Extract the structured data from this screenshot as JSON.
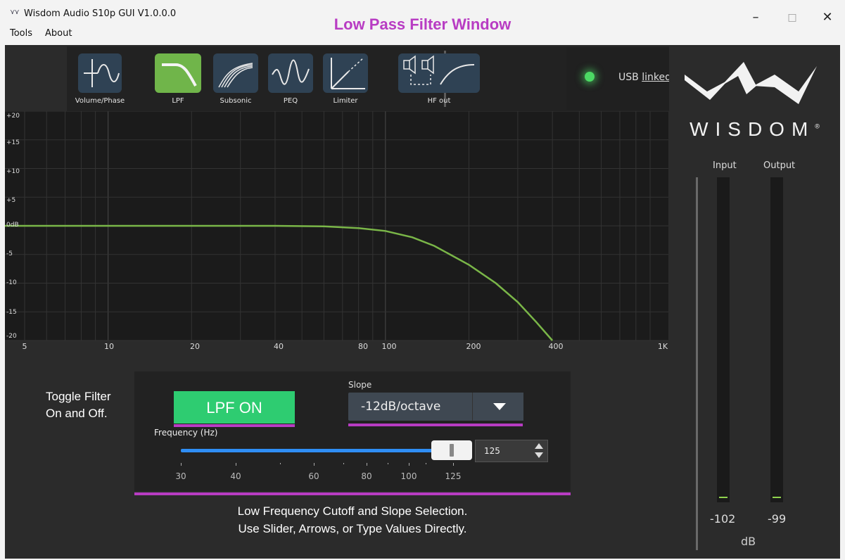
{
  "window": {
    "title": "Wisdom Audio S10p GUI V1.0.0.0",
    "menu": [
      "Tools",
      "About"
    ],
    "controls": [
      "–",
      "□",
      "✕"
    ]
  },
  "annotations": {
    "title": "Low Pass Filter Window",
    "toggle_line1": "Toggle Filter",
    "toggle_line2": "On and Off.",
    "cutoff_line1": "Low Frequency Cutoff and Slope Selection.",
    "cutoff_line2": "Use Slider, Arrows, or Type Values Directly.",
    "highlight_color": "#b83cc3"
  },
  "toolbar": {
    "buttons": [
      {
        "label": "Volume/Phase",
        "icon": "volume-phase-icon",
        "active": false
      },
      {
        "label": "LPF",
        "icon": "lowpass-curve-icon",
        "active": true
      },
      {
        "label": "Subsonic",
        "icon": "subsonic-curves-icon",
        "active": false
      },
      {
        "label": "PEQ",
        "icon": "peq-wave-icon",
        "active": false
      },
      {
        "label": "Limiter",
        "icon": "limiter-graph-icon",
        "active": false
      },
      {
        "label": "HF out",
        "icon": "hf-out-icon",
        "active": false
      }
    ],
    "active_color": "#70b54a",
    "inactive_color": "#2f4254"
  },
  "status": {
    "usb_prefix": "USB",
    "usb_state": "linked",
    "led_color": "#4cd964"
  },
  "graph": {
    "y_labels": [
      "+20",
      "+15",
      "+10",
      "+5",
      "0dB",
      "-5",
      "-10",
      "-15",
      "-20"
    ],
    "x_labels": [
      "5",
      "10",
      "20",
      "40",
      "80",
      "100",
      "200",
      "400",
      "1K"
    ],
    "curve_color": "#7ab648",
    "ylim": [
      -20,
      20
    ],
    "xlim": [
      5,
      1000
    ],
    "x_scale": "log",
    "curve_points": [
      {
        "hz": 5,
        "db": 0
      },
      {
        "hz": 40,
        "db": 0
      },
      {
        "hz": 60,
        "db": -0.1
      },
      {
        "hz": 80,
        "db": -0.4
      },
      {
        "hz": 100,
        "db": -0.9
      },
      {
        "hz": 125,
        "db": -2.0
      },
      {
        "hz": 150,
        "db": -3.5
      },
      {
        "hz": 200,
        "db": -6.8
      },
      {
        "hz": 250,
        "db": -10.0
      },
      {
        "hz": 300,
        "db": -13.3
      },
      {
        "hz": 350,
        "db": -16.8
      },
      {
        "hz": 400,
        "db": -20
      }
    ]
  },
  "filter": {
    "toggle_label": "LPF ON",
    "slope_label": "Slope",
    "slope_value": "-12dB/octave",
    "freq_label": "Frequency (Hz)",
    "freq_value": "125",
    "freq_ticks": [
      "30",
      "40",
      "60",
      "80",
      "100",
      "125"
    ],
    "on_color": "#2ecc71"
  },
  "brand": {
    "wordmark": "WISDOM",
    "registered": "®"
  },
  "meters": {
    "input_label": "Input",
    "output_label": "Output",
    "input_value": "-102",
    "output_value": "-99",
    "unit": "dB"
  }
}
